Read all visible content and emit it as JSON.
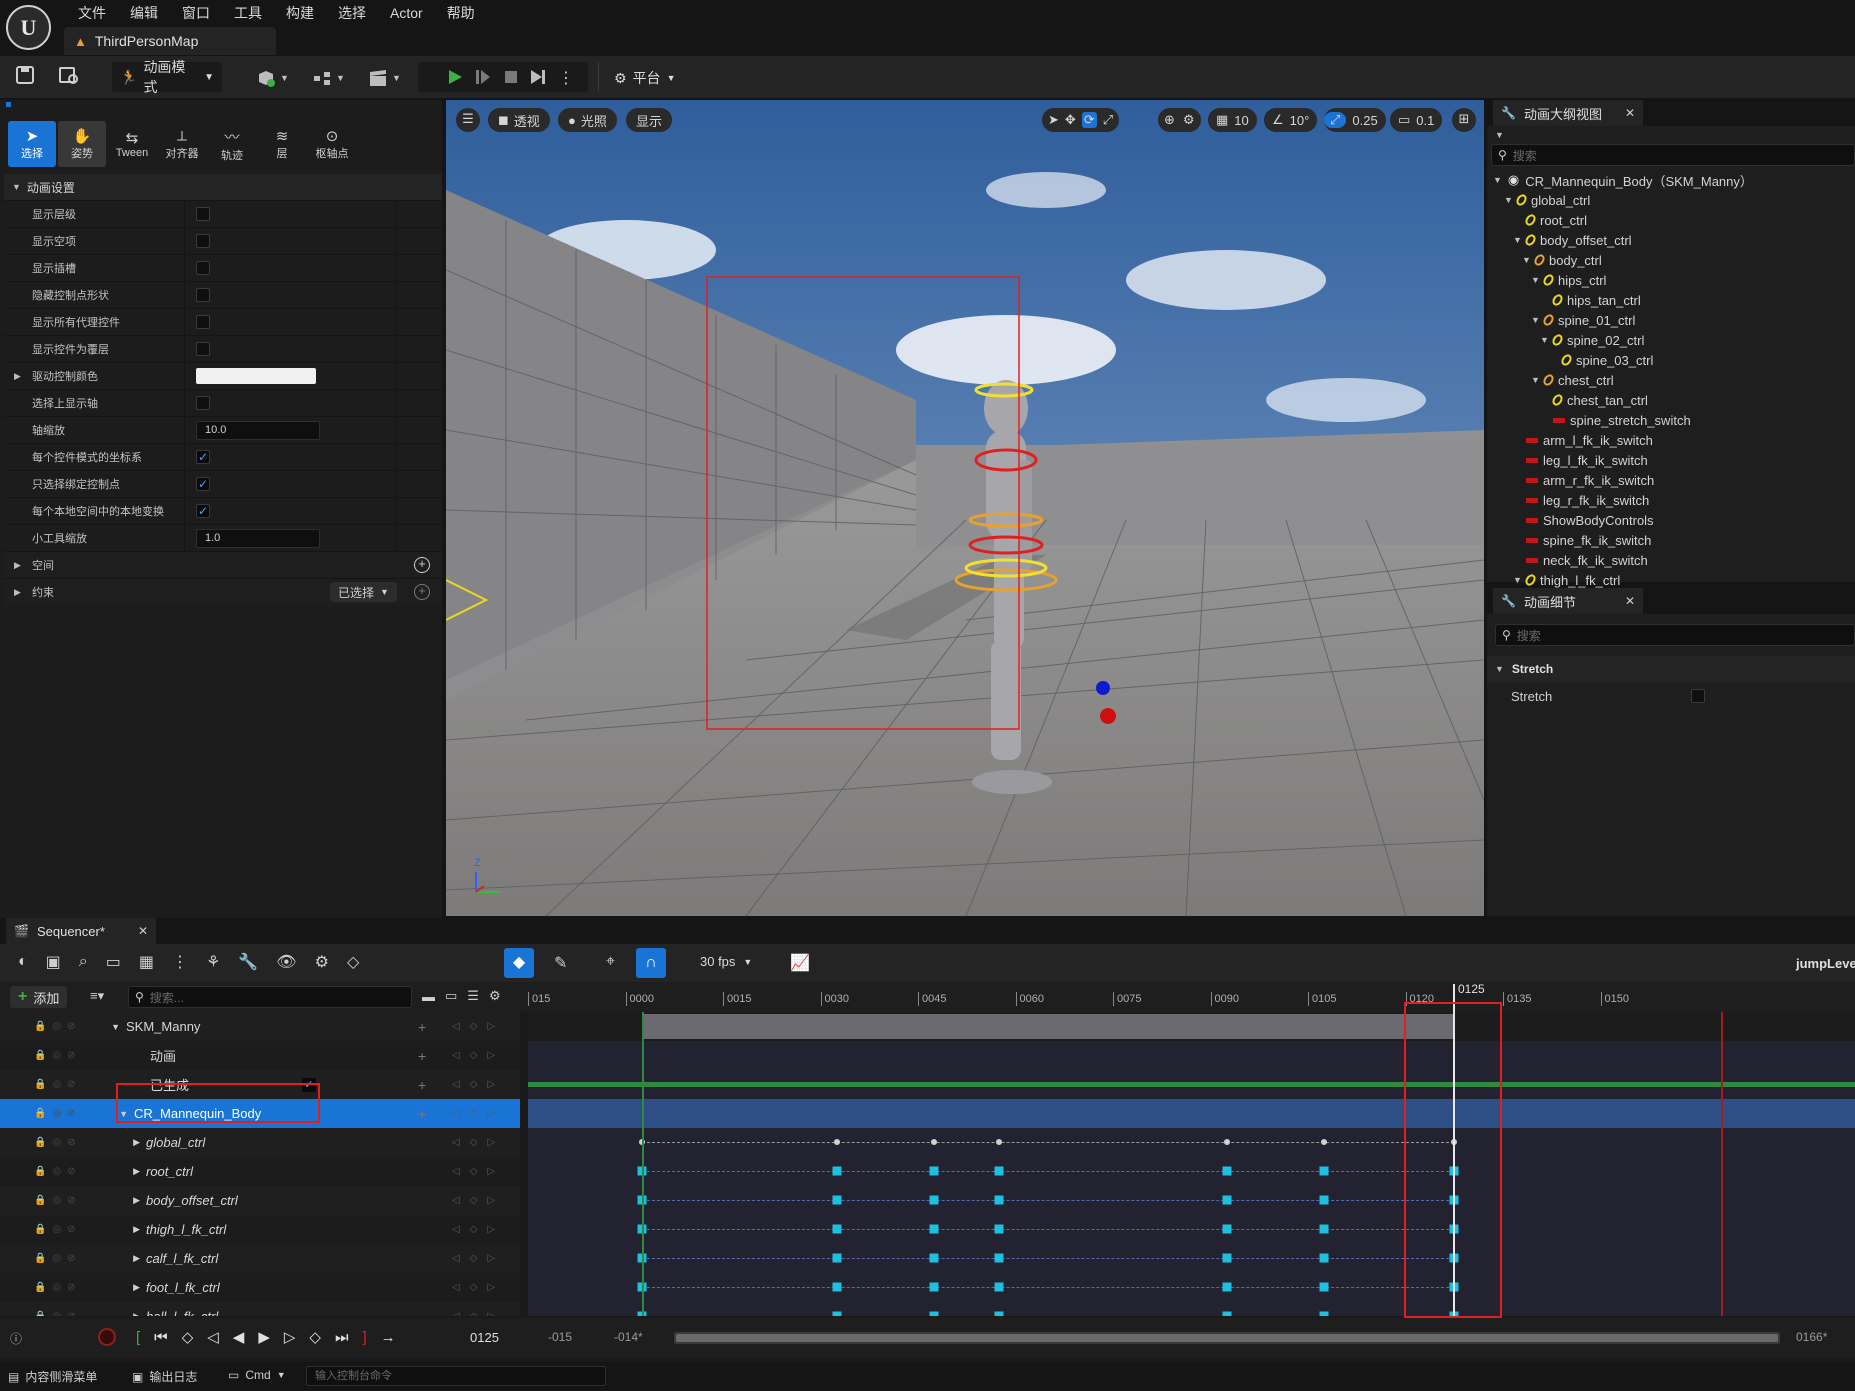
{
  "menubar": {
    "items": [
      "文件",
      "编辑",
      "窗口",
      "工具",
      "构建",
      "选择",
      "Actor",
      "帮助"
    ],
    "map_tab": "ThirdPersonMap"
  },
  "toolbar": {
    "mode_label": "动画模式",
    "platform_label": "平台"
  },
  "modes": [
    {
      "label": "选择",
      "icon": "select-arrow-icon",
      "state": "on"
    },
    {
      "label": "姿势",
      "icon": "pose-icon",
      "state": "alt"
    },
    {
      "label": "Tween",
      "icon": "tween-icon",
      "state": ""
    },
    {
      "label": "对齐器",
      "icon": "aligner-icon",
      "state": ""
    },
    {
      "label": "轨迹",
      "icon": "trail-icon",
      "state": ""
    },
    {
      "label": "层",
      "icon": "layer-icon",
      "state": ""
    },
    {
      "label": "枢轴点",
      "icon": "pivot-icon",
      "state": ""
    }
  ],
  "anim_settings": {
    "header": "动画设置",
    "rows": [
      {
        "label": "显示层级",
        "type": "check",
        "checked": false
      },
      {
        "label": "显示空项",
        "type": "check",
        "checked": false
      },
      {
        "label": "显示插槽",
        "type": "check",
        "checked": false
      },
      {
        "label": "隐藏控制点形状",
        "type": "check",
        "checked": false
      },
      {
        "label": "显示所有代理控件",
        "type": "check",
        "checked": false
      },
      {
        "label": "显示控件为覆层",
        "type": "check",
        "checked": false
      },
      {
        "label": "驱动控制颜色",
        "type": "color",
        "value": ""
      },
      {
        "label": "选择上显示轴",
        "type": "check",
        "checked": false
      },
      {
        "label": "轴缩放",
        "type": "num",
        "value": "10.0"
      },
      {
        "label": "每个控件模式的坐标系",
        "type": "check",
        "checked": true
      },
      {
        "label": "只选择绑定控制点",
        "type": "check",
        "checked": true
      },
      {
        "label": "每个本地空间中的本地变换",
        "type": "check",
        "checked": true
      },
      {
        "label": "小工具缩放",
        "type": "num",
        "value": "1.0"
      }
    ],
    "space_label": "空间",
    "constraint_label": "约束",
    "constraint_value": "已选择"
  },
  "viewport": {
    "perspective_label": "透视",
    "lighting_label": "光照",
    "show_label": "显示",
    "grid_snap": "10",
    "angle_snap": "10°",
    "scale_snap": "0.25",
    "camera_speed": "0.1",
    "axis_z": "Z"
  },
  "outliner": {
    "title": "动画大纲视图",
    "search_placeholder": "搜索",
    "root": "CR_Mannequin_Body（SKM_Manny）",
    "items": [
      {
        "label": "global_ctrl",
        "depth": 1,
        "arrow": true,
        "icon": "yellow"
      },
      {
        "label": "root_ctrl",
        "depth": 2,
        "arrow": false,
        "icon": "yellow"
      },
      {
        "label": "body_offset_ctrl",
        "depth": 2,
        "arrow": true,
        "icon": "yellow"
      },
      {
        "label": "body_ctrl",
        "depth": 3,
        "arrow": true,
        "icon": "orange"
      },
      {
        "label": "hips_ctrl",
        "depth": 4,
        "arrow": true,
        "icon": "yellow"
      },
      {
        "label": "hips_tan_ctrl",
        "depth": 5,
        "arrow": false,
        "icon": "yellow"
      },
      {
        "label": "spine_01_ctrl",
        "depth": 4,
        "arrow": true,
        "icon": "orange"
      },
      {
        "label": "spine_02_ctrl",
        "depth": 5,
        "arrow": true,
        "icon": "yellow"
      },
      {
        "label": "spine_03_ctrl",
        "depth": 6,
        "arrow": false,
        "icon": "yellow"
      },
      {
        "label": "chest_ctrl",
        "depth": 4,
        "arrow": true,
        "icon": "orange"
      },
      {
        "label": "chest_tan_ctrl",
        "depth": 5,
        "arrow": false,
        "icon": "yellow"
      },
      {
        "label": "spine_stretch_switch",
        "depth": 5,
        "arrow": false,
        "icon": "red"
      },
      {
        "label": "arm_l_fk_ik_switch",
        "depth": 2,
        "arrow": false,
        "icon": "red"
      },
      {
        "label": "leg_l_fk_ik_switch",
        "depth": 2,
        "arrow": false,
        "icon": "red"
      },
      {
        "label": "arm_r_fk_ik_switch",
        "depth": 2,
        "arrow": false,
        "icon": "red"
      },
      {
        "label": "leg_r_fk_ik_switch",
        "depth": 2,
        "arrow": false,
        "icon": "red"
      },
      {
        "label": "ShowBodyControls",
        "depth": 2,
        "arrow": false,
        "icon": "red"
      },
      {
        "label": "spine_fk_ik_switch",
        "depth": 2,
        "arrow": false,
        "icon": "red"
      },
      {
        "label": "neck_fk_ik_switch",
        "depth": 2,
        "arrow": false,
        "icon": "red"
      },
      {
        "label": "thigh_l_fk_ctrl",
        "depth": 2,
        "arrow": true,
        "icon": "yellow"
      }
    ]
  },
  "details": {
    "title": "动画细节",
    "search_placeholder": "搜索",
    "section": "Stretch",
    "row_label": "Stretch"
  },
  "sequencer": {
    "tab": "Sequencer*",
    "fps": "30 fps",
    "add_label": "添加",
    "search_placeholder": "搜索...",
    "sequence_name": "jumpLevel",
    "current_frame": "0125",
    "playhead_label": "0125",
    "range_start": "-015",
    "range_start2": "-014*",
    "range_end": "0166*",
    "ticks": [
      "015",
      "0000",
      "0015",
      "0030",
      "0045",
      "0060",
      "0075",
      "0090",
      "0105",
      "0120",
      "0135",
      "0150"
    ],
    "tracks": [
      {
        "label": "SKM_Manny",
        "kind": "actor"
      },
      {
        "label": "动画",
        "kind": "sub"
      },
      {
        "label": "已生成",
        "kind": "sub"
      },
      {
        "label": "CR_Mannequin_Body",
        "kind": "rig"
      },
      {
        "label": "global_ctrl",
        "kind": "ctrl"
      },
      {
        "label": "root_ctrl",
        "kind": "ctrl"
      },
      {
        "label": "body_offset_ctrl",
        "kind": "ctrl"
      },
      {
        "label": "thigh_l_fk_ctrl",
        "kind": "ctrl"
      },
      {
        "label": "calf_l_fk_ctrl",
        "kind": "ctrl"
      },
      {
        "label": "foot_l_fk_ctrl",
        "kind": "ctrl"
      },
      {
        "label": "ball_l_fk_ctrl",
        "kind": "ctrl"
      }
    ],
    "keyframes": [
      0,
      30,
      45,
      55,
      90,
      105,
      125
    ]
  },
  "statusbar": {
    "content_drawer": "内容侧滑菜单",
    "output_log": "输出日志",
    "cmd": "Cmd",
    "console_placeholder": "输入控制台命令"
  }
}
